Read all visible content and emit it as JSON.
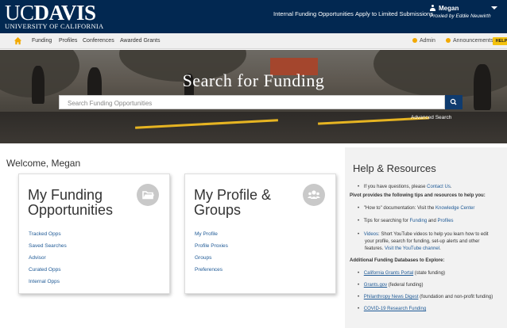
{
  "header": {
    "logo_top": "UCDAVIS",
    "logo_top_uc": "UC",
    "logo_top_davis": "DAVIS",
    "logo_sub": "UNIVERSITY OF CALIFORNIA",
    "links": [
      "Internal Funding Opportunities",
      "Apply to Limited Submissions"
    ],
    "user_name": "Megan",
    "proxy_text": "Proxied by  Eddie Neuwirth"
  },
  "nav": {
    "items": [
      "Funding",
      "Profiles",
      "Conferences",
      "Awarded Grants"
    ],
    "admin": "Admin",
    "announcements": "Announcements",
    "help": "HELP"
  },
  "hero": {
    "title": "Search for Funding",
    "search_placeholder": "Search Funding Opportunities",
    "advanced": "Advanced Search"
  },
  "welcome": "Welcome, Megan",
  "cards": [
    {
      "title": "My Funding Opportunities",
      "icon": "folder-icon",
      "links": [
        "Tracked Opps",
        "Saved Searches",
        "Advisor",
        "Curated Opps",
        "Internal Opps"
      ]
    },
    {
      "title": "My Profile & Groups",
      "icon": "group-icon",
      "links": [
        "My Profile",
        "Profile Proxies",
        "Groups",
        "Preferences"
      ]
    }
  ],
  "help": {
    "title": "Help & Resources",
    "questions_pre": "If you have questions, please ",
    "questions_link": "Contact Us",
    "questions_post": ".",
    "pivot_intro": "Pivot provides the following tips and resources to help you:",
    "howto_pre": "\"How to\" documentation: Visit the ",
    "howto_link": "Knowledge Center",
    "tips_pre": "Tips for searching for ",
    "tips_link1": "Funding",
    "tips_mid": " and ",
    "tips_link2": "Profiles",
    "videos_link": "Videos",
    "videos_l1": ": Short YouTube videos to help you learn how to edit",
    "videos_l2": "your profile, search for funding, set-up alerts and other",
    "videos_l3_pre": "features. ",
    "videos_l3_link": "Visit the YouTube channel",
    "videos_l3_post": ".",
    "databases_intro": "Additional Funding Databases to Explore:",
    "databases": [
      {
        "link": "California Grants Portal",
        "note": " (state funding)"
      },
      {
        "link": "Grants.gov",
        "note": " (federal funding)"
      },
      {
        "link": "Philanthropy News Digest",
        "note": " (foundation and non-profit funding)"
      },
      {
        "link": "COVID-19 Research Funding",
        "note": ""
      }
    ]
  },
  "colors": {
    "header_bg": "#022851",
    "accent": "#f2a900",
    "link": "#1f5a96"
  }
}
